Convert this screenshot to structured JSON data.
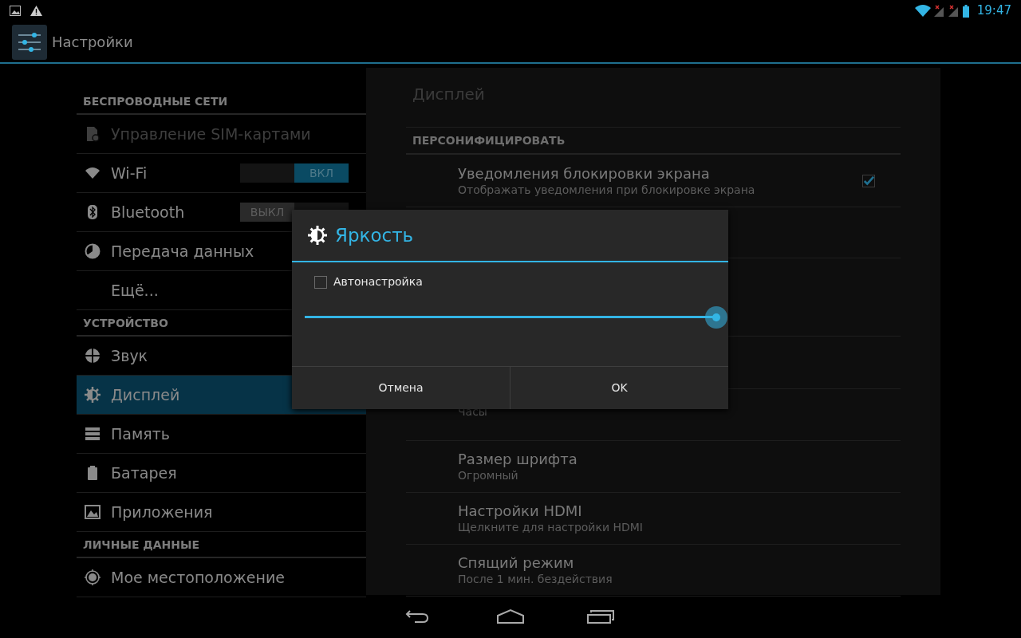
{
  "status_bar": {
    "time": "19:47"
  },
  "action_bar": {
    "title": "Настройки"
  },
  "sidebar": {
    "sections": [
      {
        "header": "БЕСПРОВОДНЫЕ СЕТИ",
        "items": [
          {
            "label": "Управление SIM-картами",
            "disabled": true,
            "selected": false
          },
          {
            "label": "Wi-Fi",
            "disabled": false,
            "selected": false,
            "toggle": {
              "label": "ВКЛ",
              "on": true
            }
          },
          {
            "label": "Bluetooth",
            "disabled": false,
            "selected": false,
            "toggle": {
              "label": "ВЫКЛ",
              "on": false
            }
          },
          {
            "label": "Передача данных",
            "disabled": false,
            "selected": false
          },
          {
            "label": "Ещё...",
            "disabled": false,
            "selected": false
          }
        ]
      },
      {
        "header": "УСТРОЙСТВО",
        "items": [
          {
            "label": "Звук",
            "disabled": false,
            "selected": false
          },
          {
            "label": "Дисплей",
            "disabled": false,
            "selected": true
          },
          {
            "label": "Память",
            "disabled": false,
            "selected": false
          },
          {
            "label": "Батарея",
            "disabled": false,
            "selected": false
          },
          {
            "label": "Приложения",
            "disabled": false,
            "selected": false
          }
        ]
      },
      {
        "header": "ЛИЧНЫЕ ДАННЫЕ",
        "items": [
          {
            "label": "Мое местоположение",
            "disabled": false,
            "selected": false
          }
        ]
      }
    ]
  },
  "panel": {
    "title": "Дисплей",
    "section_header": "ПЕРСОНИФИЦИРОВАТЬ",
    "rows": [
      {
        "title": "Уведомления блокировки экрана",
        "summary": "Отображать уведомления при блокировке экрана",
        "checked": true
      },
      {
        "summary": "Часы"
      },
      {
        "title": "Размер шрифта",
        "summary": "Огромный"
      },
      {
        "title": "Настройки HDMI",
        "summary": "Щелкните для настройки HDMI"
      },
      {
        "title": "Спящий режим",
        "summary": "После 1 мин. бездействия"
      }
    ]
  },
  "dialog": {
    "title": "Яркость",
    "auto": {
      "label": "Автонастройка",
      "checked": false
    },
    "slider": {
      "level": 1.0
    },
    "buttons": [
      "Отмена",
      "OK"
    ]
  }
}
